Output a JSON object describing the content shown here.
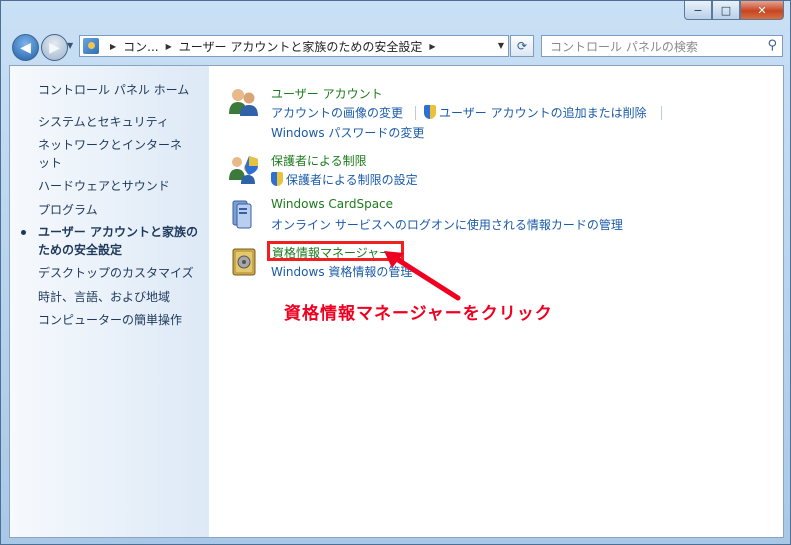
{
  "window": {
    "caption_buttons": {
      "minimize": "−",
      "maximize": "□",
      "close": "✕"
    }
  },
  "navbar": {
    "breadcrumb": [
      "コン...",
      "ユーザー アカウントと家族のための安全設定"
    ],
    "search_placeholder": "コントロール パネルの検索",
    "icons": {
      "back": "back-arrow-icon",
      "forward": "forward-arrow-icon",
      "refresh": "refresh-icon",
      "search": "search-icon"
    }
  },
  "sidebar": {
    "home": "コントロール パネル ホーム",
    "items": [
      "システムとセキュリティ",
      "ネットワークとインターネ",
      "ット",
      "ハードウェアとサウンド",
      "プログラム",
      "ユーザー アカウントと家族の",
      "ための安全設定",
      "デスクトップのカスタマイズ",
      "時計、言語、および地域",
      "コンピューターの簡単操作"
    ]
  },
  "categories": {
    "user_accounts": {
      "title": "ユーザー アカウント",
      "links": [
        "アカウントの画像の変更",
        "ユーザー アカウントの追加または削除",
        "Windows パスワードの変更"
      ]
    },
    "parental": {
      "title": "保護者による制限",
      "links": [
        "保護者による制限の設定"
      ]
    },
    "cardspace": {
      "title": "Windows CardSpace",
      "links": [
        "オンライン サービスへのログオンに使用される情報カードの管理"
      ]
    },
    "credential": {
      "title": "資格情報マネージャー",
      "links": [
        "Windows 資格情報の管理"
      ]
    }
  },
  "annotation": {
    "text": "資格情報マネージャーをクリック",
    "color": "#f00020"
  }
}
